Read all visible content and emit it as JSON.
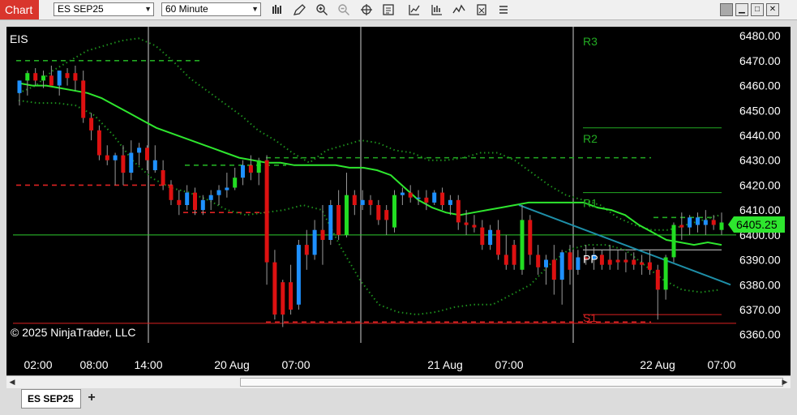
{
  "toolbar": {
    "chart_tab_label": "Chart",
    "instrument_value": "ES SEP25",
    "interval_value": "60 Minute",
    "icons": [
      "bar-style-icon",
      "drawing-pencil-icon",
      "zoom-in-icon",
      "zoom-out-icon",
      "crosshair-icon",
      "data-box-icon",
      "indicators-icon",
      "strategies-icon",
      "trade-icon",
      "templates-icon",
      "properties-icon"
    ],
    "window_buttons": [
      "window-gray-icon",
      "minimize-icon",
      "maximize-icon",
      "close-icon"
    ]
  },
  "chart": {
    "instrument_label": "EIS",
    "copyright": "© 2025 NinjaTrader, LLC",
    "current_price": "6405.25",
    "y_ticks": [
      "6480.00",
      "6470.00",
      "6460.00",
      "6450.00",
      "6440.00",
      "6430.00",
      "6420.00",
      "6410.00",
      "6400.00",
      "6390.00",
      "6380.00",
      "6370.00",
      "6360.00"
    ],
    "x_ticks": [
      "02:00",
      "08:00",
      "14:00",
      "20 Aug",
      "07:00",
      "21 Aug",
      "07:00",
      "22 Aug",
      "07:00"
    ],
    "pivot_labels": [
      "R3",
      "R2",
      "R1",
      "PP",
      "S1"
    ]
  },
  "tabs": {
    "active_tab": "ES SEP25",
    "add_tab": "+"
  },
  "colors": {
    "background": "#000000",
    "up_candle": "#22dd22",
    "down_candle": "#dd1111",
    "neutral_candle": "#1e90ff",
    "ema": "#2ee62e",
    "bollinger": "#1d8f1d",
    "pivot_dash": "#22aa22",
    "trendline": "#1e8fa8",
    "price_badge": "#2ee62e",
    "chart_tab": "#d9352c"
  },
  "chart_data": {
    "type": "candlestick",
    "ylim": [
      6360,
      6482
    ],
    "candles": [
      {
        "o": 6457,
        "h": 6462,
        "l": 6452,
        "c": 6462,
        "d": "n"
      },
      {
        "o": 6462,
        "h": 6466,
        "l": 6456,
        "c": 6465,
        "d": "u"
      },
      {
        "o": 6465,
        "h": 6467,
        "l": 6460,
        "c": 6462,
        "d": "d"
      },
      {
        "o": 6462,
        "h": 6466,
        "l": 6459,
        "c": 6464,
        "d": "u"
      },
      {
        "o": 6464,
        "h": 6468,
        "l": 6460,
        "c": 6460,
        "d": "d"
      },
      {
        "o": 6460,
        "h": 6466,
        "l": 6456,
        "c": 6466,
        "d": "n"
      },
      {
        "o": 6463,
        "h": 6467,
        "l": 6460,
        "c": 6465,
        "d": "d"
      },
      {
        "o": 6465,
        "h": 6468,
        "l": 6458,
        "c": 6462,
        "d": "d"
      },
      {
        "o": 6462,
        "h": 6466,
        "l": 6445,
        "c": 6447,
        "d": "d"
      },
      {
        "o": 6447,
        "h": 6449,
        "l": 6438,
        "c": 6442,
        "d": "d"
      },
      {
        "o": 6442,
        "h": 6444,
        "l": 6430,
        "c": 6432,
        "d": "d"
      },
      {
        "o": 6432,
        "h": 6436,
        "l": 6428,
        "c": 6430,
        "d": "d"
      },
      {
        "o": 6430,
        "h": 6433,
        "l": 6420,
        "c": 6432,
        "d": "n"
      },
      {
        "o": 6432,
        "h": 6436,
        "l": 6420,
        "c": 6425,
        "d": "d"
      },
      {
        "o": 6425,
        "h": 6438,
        "l": 6422,
        "c": 6433,
        "d": "n"
      },
      {
        "o": 6433,
        "h": 6437,
        "l": 6428,
        "c": 6435,
        "d": "n"
      },
      {
        "o": 6435,
        "h": 6436,
        "l": 6426,
        "c": 6430,
        "d": "d"
      },
      {
        "o": 6430,
        "h": 6436,
        "l": 6425,
        "c": 6426,
        "d": "n"
      },
      {
        "o": 6426,
        "h": 6430,
        "l": 6418,
        "c": 6420,
        "d": "d"
      },
      {
        "o": 6420,
        "h": 6422,
        "l": 6412,
        "c": 6414,
        "d": "d"
      },
      {
        "o": 6414,
        "h": 6418,
        "l": 6408,
        "c": 6412,
        "d": "d"
      },
      {
        "o": 6412,
        "h": 6420,
        "l": 6410,
        "c": 6417,
        "d": "n"
      },
      {
        "o": 6417,
        "h": 6419,
        "l": 6408,
        "c": 6410,
        "d": "d"
      },
      {
        "o": 6410,
        "h": 6416,
        "l": 6408,
        "c": 6414,
        "d": "n"
      },
      {
        "o": 6414,
        "h": 6418,
        "l": 6410,
        "c": 6416,
        "d": "n"
      },
      {
        "o": 6416,
        "h": 6420,
        "l": 6412,
        "c": 6418,
        "d": "n"
      },
      {
        "o": 6418,
        "h": 6425,
        "l": 6415,
        "c": 6419,
        "d": "n"
      },
      {
        "o": 6419,
        "h": 6427,
        "l": 6418,
        "c": 6423,
        "d": "u"
      },
      {
        "o": 6423,
        "h": 6430,
        "l": 6420,
        "c": 6428,
        "d": "n"
      },
      {
        "o": 6428,
        "h": 6432,
        "l": 6422,
        "c": 6425,
        "d": "d"
      },
      {
        "o": 6425,
        "h": 6431,
        "l": 6420,
        "c": 6430,
        "d": "u"
      },
      {
        "o": 6430,
        "h": 6432,
        "l": 6380,
        "c": 6389,
        "d": "d"
      },
      {
        "o": 6389,
        "h": 6394,
        "l": 6366,
        "c": 6368,
        "d": "d"
      },
      {
        "o": 6368,
        "h": 6382,
        "l": 6363,
        "c": 6381,
        "d": "d"
      },
      {
        "o": 6381,
        "h": 6388,
        "l": 6368,
        "c": 6370,
        "d": "d"
      },
      {
        "o": 6372,
        "h": 6398,
        "l": 6370,
        "c": 6396,
        "d": "n"
      },
      {
        "o": 6396,
        "h": 6402,
        "l": 6386,
        "c": 6392,
        "d": "d"
      },
      {
        "o": 6392,
        "h": 6406,
        "l": 6390,
        "c": 6402,
        "d": "n"
      },
      {
        "o": 6402,
        "h": 6412,
        "l": 6388,
        "c": 6398,
        "d": "d"
      },
      {
        "o": 6398,
        "h": 6414,
        "l": 6396,
        "c": 6412,
        "d": "n"
      },
      {
        "o": 6412,
        "h": 6418,
        "l": 6398,
        "c": 6400,
        "d": "d"
      },
      {
        "o": 6400,
        "h": 6425,
        "l": 6399,
        "c": 6416,
        "d": "u"
      },
      {
        "o": 6416,
        "h": 6418,
        "l": 6408,
        "c": 6412,
        "d": "d"
      },
      {
        "o": 6412,
        "h": 6418,
        "l": 6410,
        "c": 6414,
        "d": "n"
      },
      {
        "o": 6414,
        "h": 6416,
        "l": 6408,
        "c": 6412,
        "d": "d"
      },
      {
        "o": 6412,
        "h": 6414,
        "l": 6404,
        "c": 6406,
        "d": "d"
      },
      {
        "o": 6406,
        "h": 6412,
        "l": 6400,
        "c": 6410,
        "d": "d"
      },
      {
        "o": 6403,
        "h": 6418,
        "l": 6401,
        "c": 6416,
        "d": "u"
      },
      {
        "o": 6416,
        "h": 6419,
        "l": 6412,
        "c": 6417,
        "d": "n"
      },
      {
        "o": 6417,
        "h": 6420,
        "l": 6413,
        "c": 6415,
        "d": "d"
      },
      {
        "o": 6415,
        "h": 6418,
        "l": 6412,
        "c": 6415,
        "d": "n"
      },
      {
        "o": 6415,
        "h": 6418,
        "l": 6410,
        "c": 6413,
        "d": "d"
      },
      {
        "o": 6413,
        "h": 6418,
        "l": 6412,
        "c": 6417,
        "d": "n"
      },
      {
        "o": 6417,
        "h": 6419,
        "l": 6410,
        "c": 6412,
        "d": "d"
      },
      {
        "o": 6412,
        "h": 6416,
        "l": 6408,
        "c": 6414,
        "d": "n"
      },
      {
        "o": 6414,
        "h": 6416,
        "l": 6402,
        "c": 6405,
        "d": "d"
      },
      {
        "o": 6405,
        "h": 6410,
        "l": 6400,
        "c": 6404,
        "d": "d"
      },
      {
        "o": 6404,
        "h": 6408,
        "l": 6401,
        "c": 6403,
        "d": "d"
      },
      {
        "o": 6403,
        "h": 6406,
        "l": 6394,
        "c": 6396,
        "d": "d"
      },
      {
        "o": 6396,
        "h": 6404,
        "l": 6394,
        "c": 6402,
        "d": "n"
      },
      {
        "o": 6402,
        "h": 6406,
        "l": 6390,
        "c": 6392,
        "d": "d"
      },
      {
        "o": 6392,
        "h": 6400,
        "l": 6386,
        "c": 6388,
        "d": "d"
      },
      {
        "o": 6388,
        "h": 6398,
        "l": 6386,
        "c": 6396,
        "d": "d"
      },
      {
        "o": 6386,
        "h": 6412,
        "l": 6384,
        "c": 6406,
        "d": "u"
      },
      {
        "o": 6406,
        "h": 6408,
        "l": 6388,
        "c": 6392,
        "d": "d"
      },
      {
        "o": 6392,
        "h": 6396,
        "l": 6384,
        "c": 6387,
        "d": "d"
      },
      {
        "o": 6387,
        "h": 6392,
        "l": 6380,
        "c": 6390,
        "d": "n"
      },
      {
        "o": 6390,
        "h": 6396,
        "l": 6376,
        "c": 6382,
        "d": "d"
      },
      {
        "o": 6382,
        "h": 6394,
        "l": 6372,
        "c": 6393,
        "d": "n"
      },
      {
        "o": 6393,
        "h": 6396,
        "l": 6380,
        "c": 6386,
        "d": "d"
      },
      {
        "o": 6386,
        "h": 6394,
        "l": 6384,
        "c": 6391,
        "d": "n"
      },
      {
        "o": 6391,
        "h": 6396,
        "l": 6388,
        "c": 6390,
        "d": "d"
      },
      {
        "o": 6390,
        "h": 6395,
        "l": 6386,
        "c": 6392,
        "d": "n"
      },
      {
        "o": 6392,
        "h": 6394,
        "l": 6386,
        "c": 6388,
        "d": "d"
      },
      {
        "o": 6388,
        "h": 6396,
        "l": 6386,
        "c": 6390,
        "d": "d"
      },
      {
        "o": 6390,
        "h": 6394,
        "l": 6386,
        "c": 6389,
        "d": "d"
      },
      {
        "o": 6389,
        "h": 6393,
        "l": 6385,
        "c": 6390,
        "d": "d"
      },
      {
        "o": 6390,
        "h": 6393,
        "l": 6386,
        "c": 6388,
        "d": "d"
      },
      {
        "o": 6388,
        "h": 6392,
        "l": 6384,
        "c": 6389,
        "d": "d"
      },
      {
        "o": 6389,
        "h": 6394,
        "l": 6384,
        "c": 6386,
        "d": "d"
      },
      {
        "o": 6386,
        "h": 6388,
        "l": 6366,
        "c": 6378,
        "d": "d"
      },
      {
        "o": 6378,
        "h": 6392,
        "l": 6374,
        "c": 6391,
        "d": "u"
      },
      {
        "o": 6391,
        "h": 6405,
        "l": 6389,
        "c": 6404,
        "d": "u"
      },
      {
        "o": 6404,
        "h": 6409,
        "l": 6398,
        "c": 6403,
        "d": "d"
      },
      {
        "o": 6403,
        "h": 6408,
        "l": 6400,
        "c": 6407,
        "d": "n"
      },
      {
        "o": 6407,
        "h": 6409,
        "l": 6401,
        "c": 6404,
        "d": "n"
      },
      {
        "o": 6404,
        "h": 6410,
        "l": 6400,
        "c": 6406,
        "d": "n"
      },
      {
        "o": 6406,
        "h": 6408,
        "l": 6402,
        "c": 6404,
        "d": "d"
      },
      {
        "o": 6402,
        "h": 6409,
        "l": 6400,
        "c": 6405,
        "d": "u"
      }
    ],
    "ema": [
      6461,
      6460,
      6460,
      6459,
      6458,
      6457,
      6455,
      6452,
      6449,
      6446,
      6443,
      6441,
      6439,
      6437,
      6435,
      6433,
      6431,
      6430,
      6429,
      6429,
      6428,
      6428,
      6428,
      6428,
      6427,
      6427,
      6426,
      6424,
      6419,
      6414,
      6411,
      6409,
      6408,
      6409,
      6410,
      6411,
      6412,
      6413,
      6413,
      6413,
      6413,
      6413,
      6411,
      6410,
      6408,
      6404,
      6401,
      6398,
      6397,
      6396,
      6397,
      6396
    ],
    "bb_upper": [
      6457,
      6460,
      6466,
      6470,
      6474,
      6476,
      6478,
      6479,
      6476,
      6470,
      6463,
      6458,
      6453,
      6448,
      6442,
      6438,
      6433,
      6429,
      6434,
      6436,
      6438,
      6437,
      6434,
      6433,
      6430,
      6430,
      6431,
      6433,
      6433,
      6430,
      6425,
      6420,
      6416,
      6414,
      6412,
      6407,
      6404,
      6402,
      6402,
      6404,
      6406,
      6408
    ],
    "bb_lower": [
      6454,
      6453,
      6453,
      6452,
      6448,
      6440,
      6430,
      6423,
      6419,
      6417,
      6414,
      6410,
      6408,
      6409,
      6410,
      6412,
      6410,
      6395,
      6382,
      6372,
      6369,
      6368,
      6369,
      6371,
      6372,
      6372,
      6376,
      6380,
      6388,
      6394,
      6396,
      6396,
      6394,
      6388,
      6382,
      6378,
      6377,
      6378
    ],
    "pivots": {
      "R3": 6482,
      "R2": 6443,
      "R1": 6417,
      "PP": 6394,
      "S1": 6368
    },
    "prior_levels": [
      {
        "price": 6470,
        "style": "dash",
        "color": "green"
      },
      {
        "price": 6428,
        "style": "dash",
        "color": "green"
      },
      {
        "price": 6420,
        "style": "dash",
        "color": "red"
      },
      {
        "price": 6409,
        "style": "dash",
        "color": "red"
      },
      {
        "price": 6431,
        "style": "dash",
        "color": "green"
      },
      {
        "price": 6365,
        "style": "dash",
        "color": "red"
      },
      {
        "price": 6407,
        "style": "dash",
        "color": "green"
      }
    ],
    "horizontal_lines": [
      6400,
      6364.5
    ],
    "trendline": {
      "from": 6412,
      "to": 6380
    }
  }
}
